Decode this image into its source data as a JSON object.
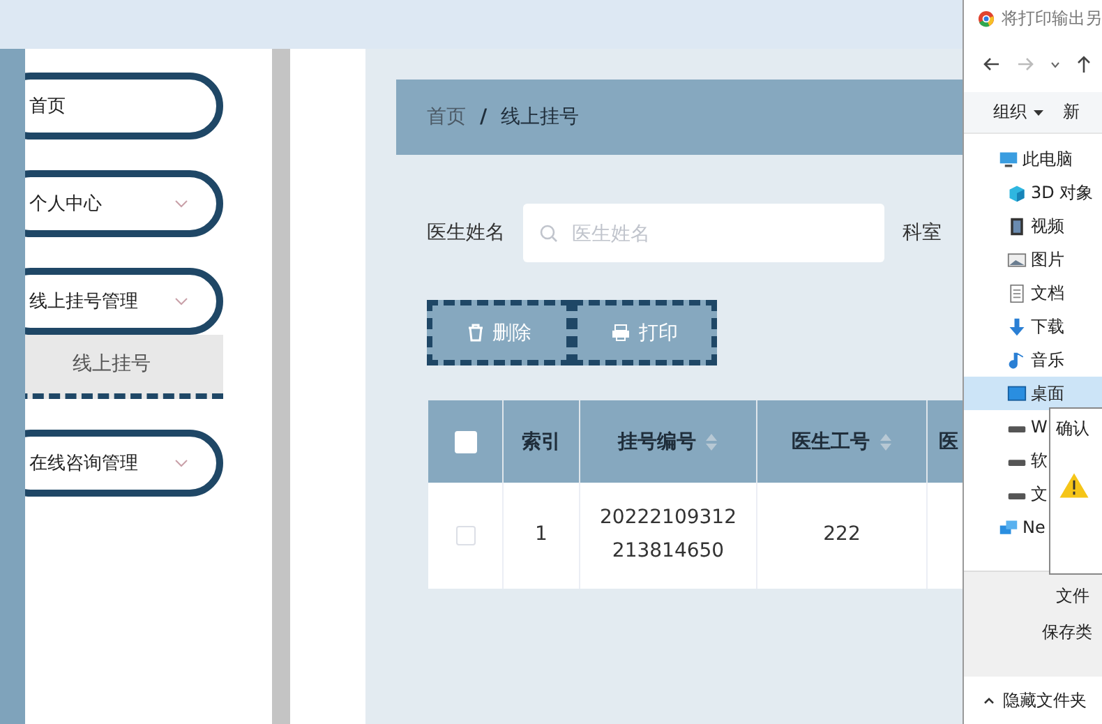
{
  "sidebar": {
    "items": [
      {
        "label": "首页",
        "kind": "link"
      },
      {
        "label": "个人中心",
        "kind": "menu"
      },
      {
        "label": "线上挂号管理",
        "kind": "menu",
        "children": [
          {
            "label": "线上挂号",
            "selected": true
          }
        ]
      },
      {
        "label": "在线咨询管理",
        "kind": "menu"
      }
    ]
  },
  "breadcrumb": {
    "items": [
      "首页",
      "线上挂号"
    ],
    "separator": "/"
  },
  "search": {
    "fields": [
      {
        "label": "医生姓名",
        "placeholder": "医生姓名"
      },
      {
        "label": "科室"
      }
    ]
  },
  "actions": [
    {
      "label": "删除",
      "kind": "delete"
    },
    {
      "label": "打印",
      "kind": "print"
    }
  ],
  "table": {
    "header_checked": false,
    "columns": [
      {
        "label": "索引",
        "sortable": false
      },
      {
        "label": "挂号编号",
        "sortable": true
      },
      {
        "label": "医生工号",
        "sortable": true
      },
      {
        "label": "医"
      }
    ],
    "rows": [
      {
        "checked": false,
        "cells": [
          "1",
          "20222109312213814650",
          "222",
          ""
        ]
      }
    ]
  },
  "save_dialog": {
    "title": "将打印输出另",
    "toolbar": [
      "组织",
      "新"
    ],
    "tree": [
      {
        "label": "此电脑",
        "kind": "pc",
        "selected": false,
        "children": [
          {
            "label": "3D 对象",
            "kind": "cube",
            "selected": false
          },
          {
            "label": "视频",
            "kind": "video",
            "selected": false
          },
          {
            "label": "图片",
            "kind": "image",
            "selected": false
          },
          {
            "label": "文档",
            "kind": "doc",
            "selected": false
          },
          {
            "label": "下载",
            "kind": "download",
            "selected": false
          },
          {
            "label": "音乐",
            "kind": "music",
            "selected": false
          },
          {
            "label": "桌面",
            "kind": "desktop",
            "selected": true
          },
          {
            "label": "W",
            "kind": "drive",
            "selected": false
          },
          {
            "label": "软",
            "kind": "drive",
            "selected": false
          },
          {
            "label": "文",
            "kind": "drive",
            "selected": false
          }
        ]
      },
      {
        "label": "Ne",
        "kind": "network",
        "selected": false
      }
    ],
    "fields": [
      "文件",
      "保存类"
    ],
    "hide_folders": "隐藏文件夹",
    "confirm": {
      "title": "确认"
    }
  }
}
